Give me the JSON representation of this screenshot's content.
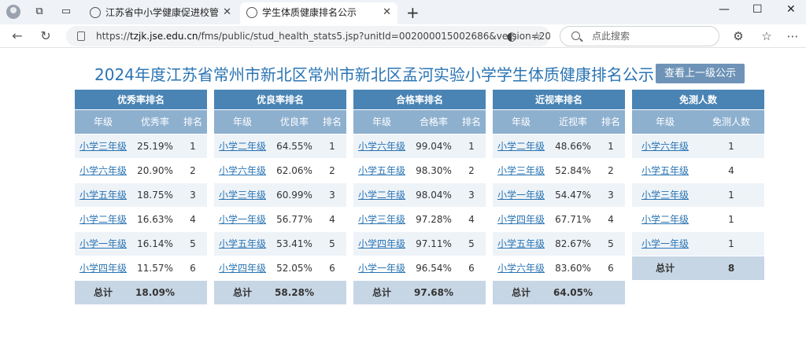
{
  "browser": {
    "tabs": [
      {
        "title": "江苏省中小学健康促进校管理系统",
        "active": false
      },
      {
        "title": "学生体质健康排名公示",
        "active": true
      }
    ],
    "url_host": "tzjk.jse.edu.cn",
    "url_path": "/fms/public/stud_health_stats5.jsp?unitId=002000015002686&version=20...",
    "search_placeholder": "点此搜索"
  },
  "page": {
    "title": "2024年度江苏省常州市新北区常州市新北区孟河实验小学学生体质健康排名公示",
    "prev_button": "查看上一级公示"
  },
  "tables": [
    {
      "title": "优秀率排名",
      "headers": [
        "年级",
        "优秀率",
        "排名"
      ],
      "rows": [
        {
          "grade": "小学三年级",
          "rate": "25.19%",
          "rank": "1"
        },
        {
          "grade": "小学六年级",
          "rate": "20.90%",
          "rank": "2"
        },
        {
          "grade": "小学五年级",
          "rate": "18.75%",
          "rank": "3"
        },
        {
          "grade": "小学二年级",
          "rate": "16.63%",
          "rank": "4"
        },
        {
          "grade": "小学一年级",
          "rate": "16.14%",
          "rank": "5"
        },
        {
          "grade": "小学四年级",
          "rate": "11.57%",
          "rank": "6"
        }
      ],
      "total_label": "总计",
      "total_value": "18.09%"
    },
    {
      "title": "优良率排名",
      "headers": [
        "年级",
        "优良率",
        "排名"
      ],
      "rows": [
        {
          "grade": "小学二年级",
          "rate": "64.55%",
          "rank": "1"
        },
        {
          "grade": "小学六年级",
          "rate": "62.06%",
          "rank": "2"
        },
        {
          "grade": "小学三年级",
          "rate": "60.99%",
          "rank": "3"
        },
        {
          "grade": "小学一年级",
          "rate": "56.77%",
          "rank": "4"
        },
        {
          "grade": "小学五年级",
          "rate": "53.41%",
          "rank": "5"
        },
        {
          "grade": "小学四年级",
          "rate": "52.05%",
          "rank": "6"
        }
      ],
      "total_label": "总计",
      "total_value": "58.28%"
    },
    {
      "title": "合格率排名",
      "headers": [
        "年级",
        "合格率",
        "排名"
      ],
      "rows": [
        {
          "grade": "小学六年级",
          "rate": "99.04%",
          "rank": "1"
        },
        {
          "grade": "小学五年级",
          "rate": "98.30%",
          "rank": "2"
        },
        {
          "grade": "小学二年级",
          "rate": "98.04%",
          "rank": "3"
        },
        {
          "grade": "小学三年级",
          "rate": "97.28%",
          "rank": "4"
        },
        {
          "grade": "小学四年级",
          "rate": "97.11%",
          "rank": "5"
        },
        {
          "grade": "小学一年级",
          "rate": "96.54%",
          "rank": "6"
        }
      ],
      "total_label": "总计",
      "total_value": "97.68%"
    },
    {
      "title": "近视率排名",
      "headers": [
        "年级",
        "近视率",
        "排名"
      ],
      "rows": [
        {
          "grade": "小学二年级",
          "rate": "48.66%",
          "rank": "1"
        },
        {
          "grade": "小学三年级",
          "rate": "52.84%",
          "rank": "2"
        },
        {
          "grade": "小学一年级",
          "rate": "54.47%",
          "rank": "3"
        },
        {
          "grade": "小学四年级",
          "rate": "67.71%",
          "rank": "4"
        },
        {
          "grade": "小学五年级",
          "rate": "82.67%",
          "rank": "5"
        },
        {
          "grade": "小学六年级",
          "rate": "83.60%",
          "rank": "6"
        }
      ],
      "total_label": "总计",
      "total_value": "64.05%"
    },
    {
      "title": "免测人数",
      "headers": [
        "年级",
        "免测人数"
      ],
      "rows": [
        {
          "grade": "小学六年级",
          "count": "1"
        },
        {
          "grade": "小学五年级",
          "count": "4"
        },
        {
          "grade": "小学三年级",
          "count": "1"
        },
        {
          "grade": "小学二年级",
          "count": "1"
        },
        {
          "grade": "小学一年级",
          "count": "1"
        }
      ],
      "total_label": "总计",
      "total_value": "8"
    }
  ]
}
